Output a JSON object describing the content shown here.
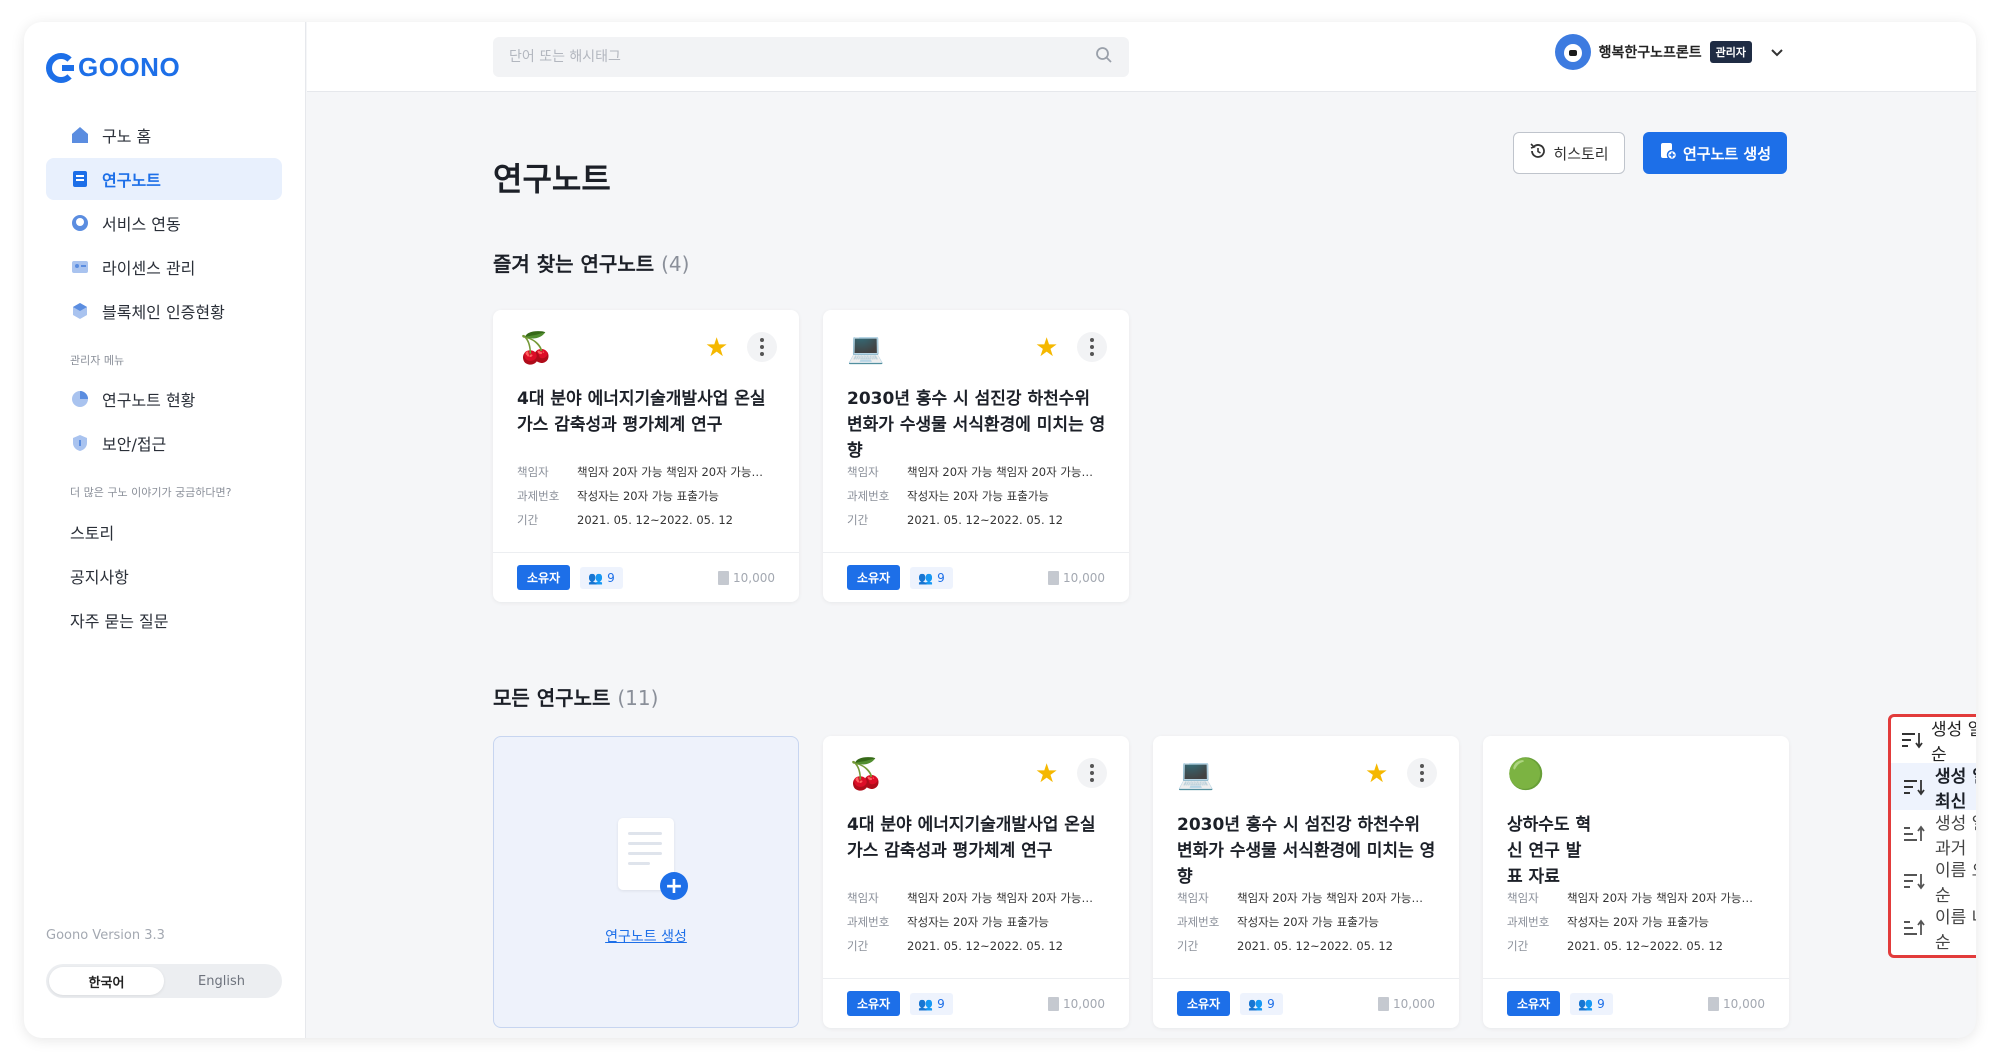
{
  "brand": {
    "logo_text": "GOONO",
    "accent": "#1d6fe8"
  },
  "sidebar": {
    "nav": [
      {
        "label": "구노 홈",
        "icon": "home-icon",
        "active": false
      },
      {
        "label": "연구노트",
        "icon": "note-icon",
        "active": true
      },
      {
        "label": "서비스 연동",
        "icon": "github-icon",
        "active": false
      },
      {
        "label": "라이센스 관리",
        "icon": "license-icon",
        "active": false
      },
      {
        "label": "블록체인 인증현황",
        "icon": "blockchain-icon",
        "active": false
      }
    ],
    "admin_label": "관리자 메뉴",
    "admin_nav": [
      {
        "label": "연구노트 현황",
        "icon": "pie-chart-icon"
      },
      {
        "label": "보안/접근",
        "icon": "shield-icon"
      }
    ],
    "more_label": "더 많은 구노 이야기가 궁금하다면?",
    "links": [
      "스토리",
      "공지사항",
      "자주 묻는 질문"
    ],
    "version": "Goono Version 3.3",
    "languages": [
      "한국어",
      "English"
    ],
    "selected_language": "한국어"
  },
  "topbar": {
    "search_placeholder": "단어 또는 해시태그",
    "user_name": "행복한구노프론트",
    "role": "관리자"
  },
  "main": {
    "title": "연구노트",
    "history_label": "히스토리",
    "create_label": "연구노트 생성",
    "favorites_title": "즐겨 찾는 연구노트",
    "favorites_count": "(4)",
    "all_title": "모든 연구노트",
    "all_count": "(11)",
    "new_card_label": "연구노트 생성"
  },
  "meta_keys": {
    "owner": "책임자",
    "project": "과제번호",
    "period": "기간"
  },
  "cards_favorites": [
    {
      "emoji": "🍒",
      "title": "4대 분야 에너지기술개발사업 온실가스 감축성과 평가체계 연구",
      "owner": "책임자 20자 가능 책임자 20자 가능…",
      "project": "작성자는 20자 가능 표출가능",
      "period": "2021. 05. 12~2022. 05. 12",
      "role": "소유자",
      "members": "9",
      "pages": "10,000"
    },
    {
      "emoji": "💻",
      "title": "2030년 홍수 시 섬진강 하천수위 변화가 수생물 서식환경에 미치는 영향",
      "owner": "책임자 20자 가능 책임자 20자 가능…",
      "project": "작성자는 20자 가능 표출가능",
      "period": "2021. 05. 12~2022. 05. 12",
      "role": "소유자",
      "members": "9",
      "pages": "10,000"
    }
  ],
  "cards_all": [
    {
      "emoji": "🍒",
      "title": "4대 분야 에너지기술개발사업 온실가스 감축성과 평가체계 연구",
      "owner": "책임자 20자 가능 책임자 20자 가능…",
      "project": "작성자는 20자 가능 표출가능",
      "period": "2021. 05. 12~2022. 05. 12",
      "role": "소유자",
      "members": "9",
      "pages": "10,000"
    },
    {
      "emoji": "💻",
      "title": "2030년 홍수 시 섬진강 하천수위 변화가 수생물 서식환경에 미치는 영향",
      "owner": "책임자 20자 가능 책임자 20자 가능…",
      "project": "작성자는 20자 가능 표출가능",
      "period": "2021. 05. 12~2022. 05. 12",
      "role": "소유자",
      "members": "9",
      "pages": "10,000"
    },
    {
      "emoji": "🟢",
      "title": "상하수도 혁신 연구 발표 자료",
      "owner": "책임자 20자 가능 책임자 20자 가능…",
      "project": "작성자는 20자 가능 표출가능",
      "period": "2021. 05. 12~2022. 05. 12",
      "role": "소유자",
      "members": "9",
      "pages": "10,000"
    }
  ],
  "sort": {
    "current": "생성 일자순",
    "options": [
      "생성 일자 최신",
      "생성 일자 과거",
      "이름 오름차순",
      "이름 내림차순"
    ],
    "selected": "생성 일자 최신",
    "highlight_color": "#e23b3b"
  }
}
